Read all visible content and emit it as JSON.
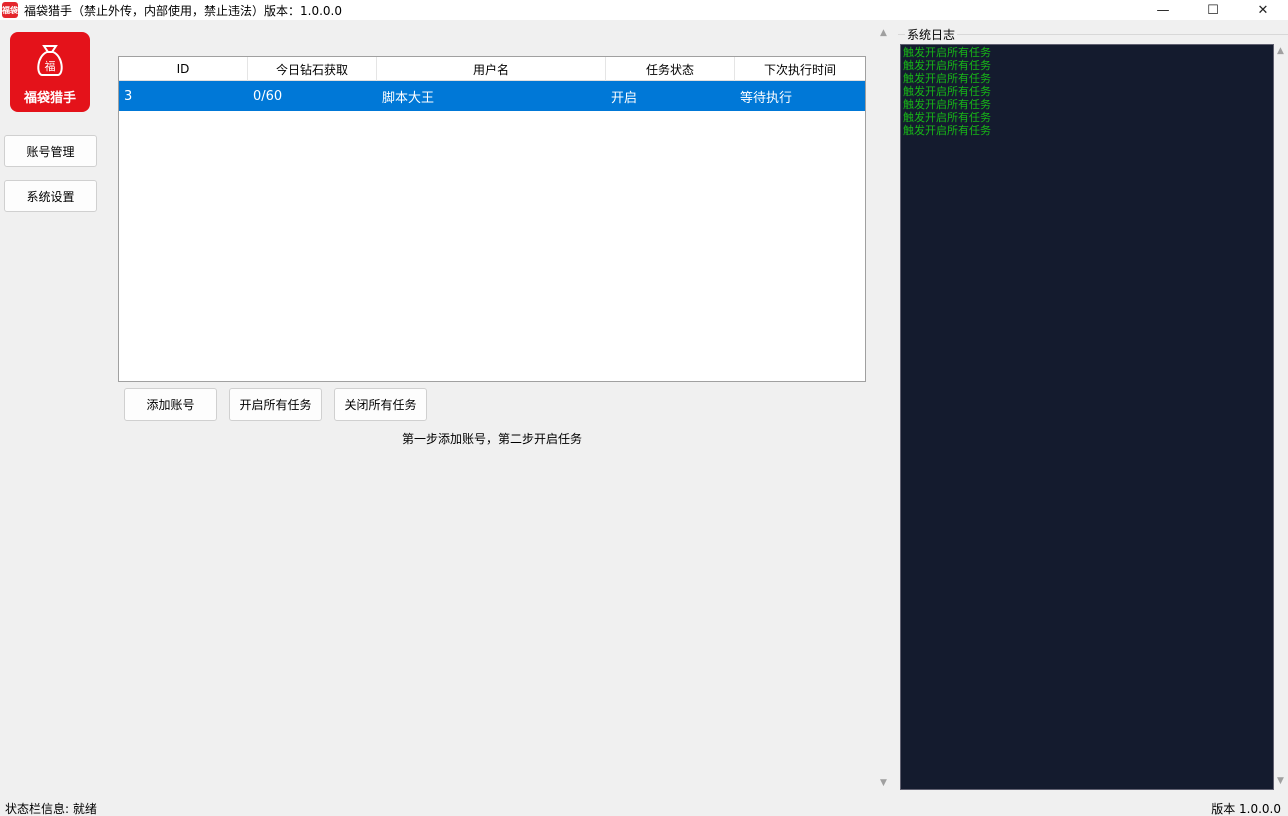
{
  "window": {
    "title": "福袋猎手（禁止外传，内部使用，禁止违法）版本：1.0.0.0",
    "icon_text": "福袋",
    "controls": [
      "—",
      "☐",
      "✕"
    ]
  },
  "sidebar": {
    "logo_text": "福袋猎手",
    "logo_glyph": "福",
    "items": [
      {
        "label": "账号管理"
      },
      {
        "label": "系统设置"
      }
    ]
  },
  "table": {
    "headers": [
      "ID",
      "今日钻石获取",
      "用户名",
      "任务状态",
      "下次执行时间"
    ],
    "rows": [
      [
        "3",
        "0/60",
        "脚本大王",
        "开启",
        "等待执行"
      ]
    ],
    "selected_row_color": "#0078d7"
  },
  "actions": {
    "add_account": "添加账号",
    "start_all": "开启所有任务",
    "stop_all": "关闭所有任务",
    "hint": "第一步添加账号，第二步开启任务"
  },
  "log": {
    "title": "系统日志",
    "lines": [
      "触发开启所有任务",
      "触发开启所有任务",
      "触发开启所有任务",
      "触发开启所有任务",
      "触发开启所有任务",
      "触发开启所有任务",
      "触发开启所有任务"
    ],
    "text_color": "#17b617",
    "background": "#141b2e"
  },
  "status": {
    "left": "状态栏信息: 就绪",
    "right": "版本 1.0.0.0"
  },
  "colors": {
    "brand": "#e4121a",
    "accent": "#0078d7"
  }
}
